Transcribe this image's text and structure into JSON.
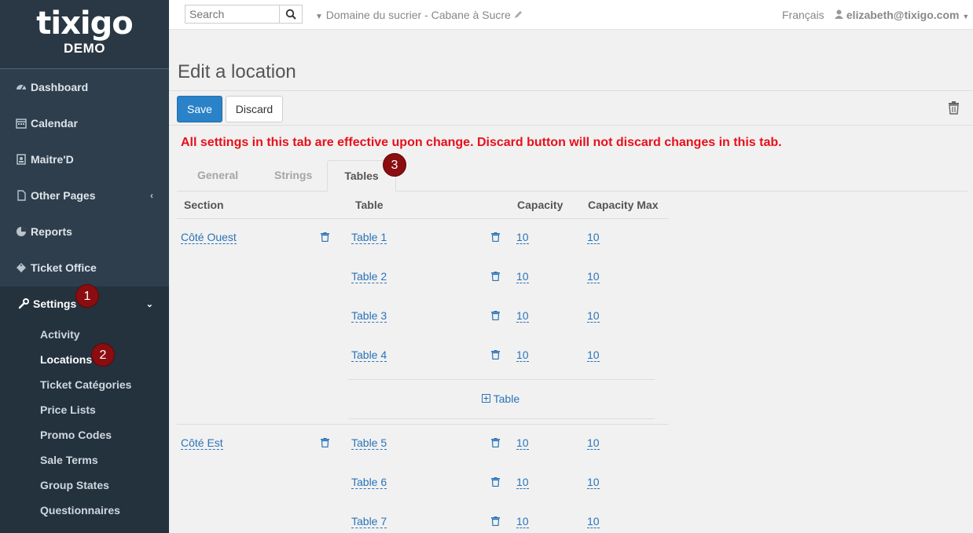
{
  "brand": {
    "logo": "tixigo",
    "subtitle": "DEMO"
  },
  "sidebar": {
    "items": [
      {
        "label": "Dashboard",
        "icon": "dashboard-icon"
      },
      {
        "label": "Calendar",
        "icon": "calendar-icon"
      },
      {
        "label": "Maitre'D",
        "icon": "maitred-icon"
      },
      {
        "label": "Other Pages",
        "icon": "file-icon"
      },
      {
        "label": "Reports",
        "icon": "pie-chart-icon"
      },
      {
        "label": "Ticket Office",
        "icon": "ticket-icon"
      }
    ],
    "settings": {
      "label": "Settings",
      "icon": "wrench-icon"
    },
    "sub_items": [
      {
        "label": "Activity"
      },
      {
        "label": "Locations"
      },
      {
        "label": "Ticket Catégories"
      },
      {
        "label": "Price Lists"
      },
      {
        "label": "Promo Codes"
      },
      {
        "label": "Sale Terms"
      },
      {
        "label": "Group States"
      },
      {
        "label": "Questionnaires"
      }
    ]
  },
  "badges": [
    "1",
    "2",
    "3"
  ],
  "topbar": {
    "search_placeholder": "Search",
    "organization": "Domaine du sucrier - Cabane à Sucre",
    "language": "Français",
    "user": "elizabeth@tixigo.com"
  },
  "page": {
    "title": "Edit a location",
    "save_label": "Save",
    "discard_label": "Discard",
    "warning": "All settings in this tab are effective upon change. Discard button will not discard changes in this tab."
  },
  "tabs": [
    "General",
    "Strings",
    "Tables"
  ],
  "table": {
    "headers": {
      "section": "Section",
      "table": "Table",
      "capacity": "Capacity",
      "capacity_max": "Capacity Max"
    },
    "add_label": "Table",
    "sections": [
      {
        "name": "Côté Ouest",
        "tables": [
          {
            "name": "Table 1",
            "capacity": "10",
            "capacity_max": "10"
          },
          {
            "name": "Table 2",
            "capacity": "10",
            "capacity_max": "10"
          },
          {
            "name": "Table 3",
            "capacity": "10",
            "capacity_max": "10"
          },
          {
            "name": "Table 4",
            "capacity": "10",
            "capacity_max": "10"
          }
        ]
      },
      {
        "name": "Côté Est",
        "tables": [
          {
            "name": "Table 5",
            "capacity": "10",
            "capacity_max": "10"
          },
          {
            "name": "Table 6",
            "capacity": "10",
            "capacity_max": "10"
          },
          {
            "name": "Table 7",
            "capacity": "10",
            "capacity_max": "10"
          }
        ]
      }
    ]
  },
  "colors": {
    "sidebar": "#2e3e4d",
    "primary": "#2a82c8",
    "warning": "#e8101a",
    "badge": "#8b0d0f",
    "link": "#2a73b8"
  }
}
